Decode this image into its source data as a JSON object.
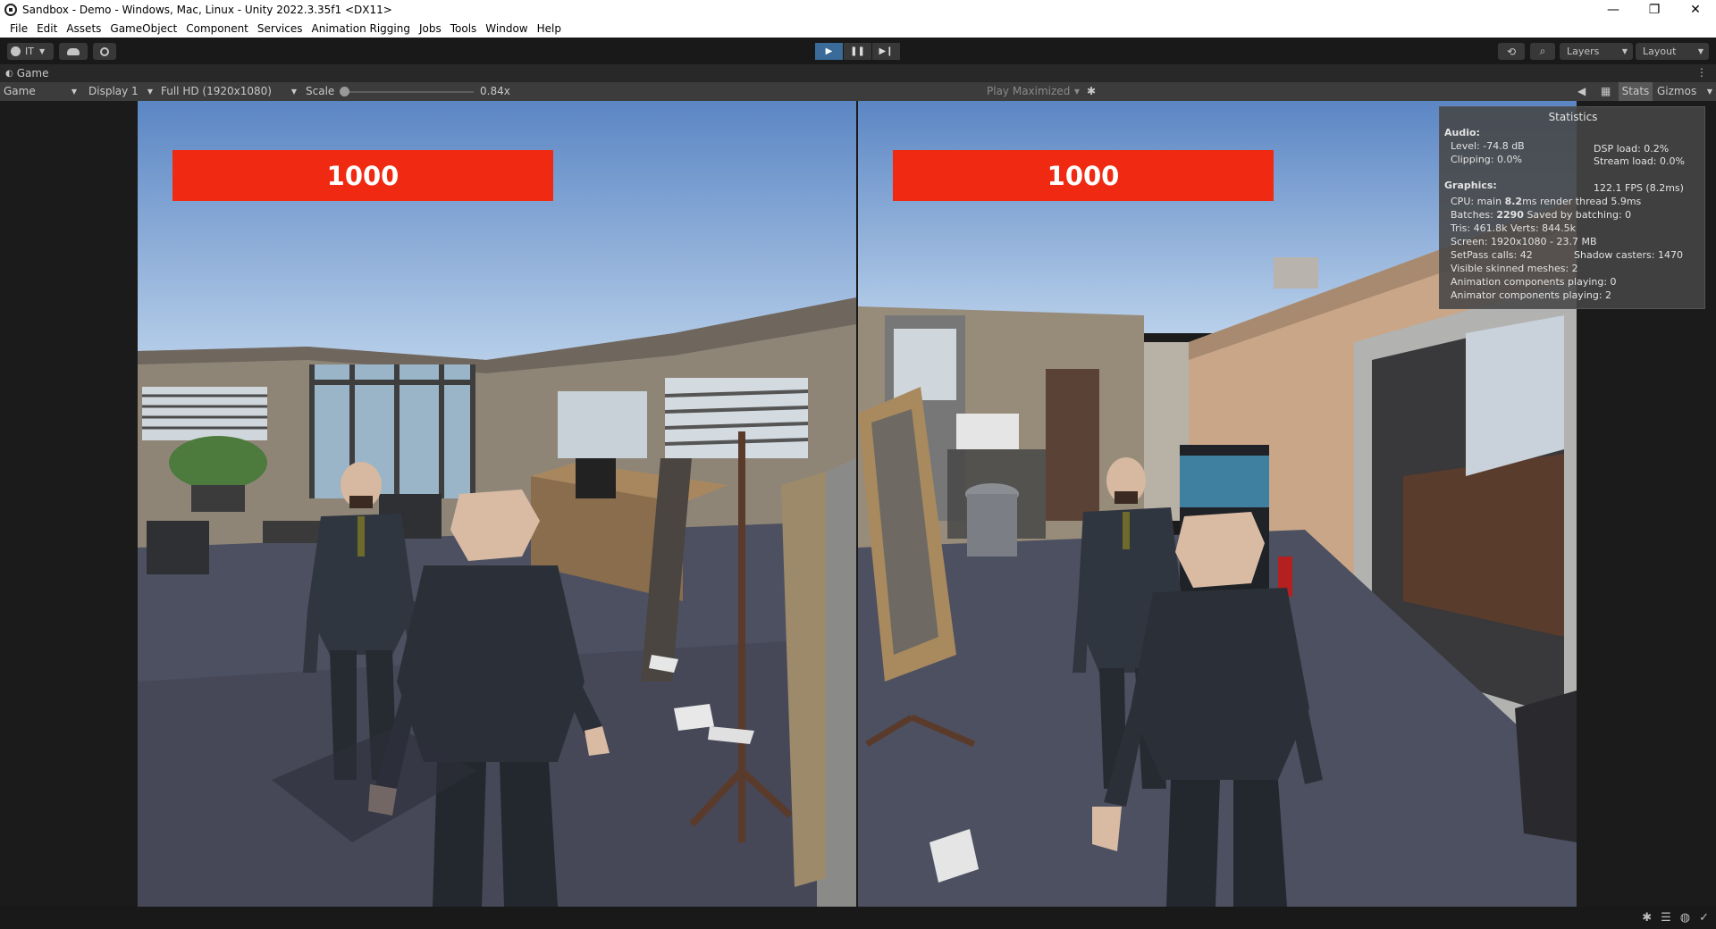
{
  "window": {
    "title": "Sandbox - Demo - Windows, Mac, Linux - Unity 2022.3.35f1 <DX11>",
    "minimize_glyph": "—",
    "restore_glyph": "❐",
    "close_glyph": "✕"
  },
  "menu": [
    "File",
    "Edit",
    "Assets",
    "GameObject",
    "Component",
    "Services",
    "Animation Rigging",
    "Jobs",
    "Tools",
    "Window",
    "Help"
  ],
  "toolbar": {
    "account_label": "IT",
    "layers_label": "Layers",
    "layout_label": "Layout",
    "play_state": "playing"
  },
  "game_tab": {
    "title": "Game"
  },
  "game_toolbar": {
    "view_select": "Game",
    "display_select": "Display 1",
    "resolution_select": "Full HD (1920x1080)",
    "scale_label": "Scale",
    "scale_value": "0.84x",
    "scale_fraction": 0,
    "play_mode_select": "Play Maximized",
    "stats_label": "Stats",
    "gizmos_label": "Gizmos"
  },
  "hud": {
    "left_score": "1000",
    "right_score": "1000"
  },
  "statistics": {
    "title": "Statistics",
    "audio_header": "Audio:",
    "level": "Level: -74.8 dB",
    "clipping": "Clipping: 0.0%",
    "dsp_load": "DSP load: 0.2%",
    "stream_load": "Stream load: 0.0%",
    "graphics_header": "Graphics:",
    "fps": "122.1 FPS (8.2ms)",
    "cpu_prefix": "CPU: main ",
    "cpu_main": "8.2",
    "cpu_suffix": "ms  render thread 5.9ms",
    "batches_prefix": "Batches: ",
    "batches_value": "2290",
    "batches_suffix": "   Saved by batching: 0",
    "tris_verts": "Tris: 461.8k     Verts: 844.5k",
    "screen": "Screen: 1920x1080 - 23.7 MB",
    "setpass": "SetPass calls: 42",
    "shadow_casters": "Shadow casters: 1470",
    "skinned_meshes": "Visible skinned meshes: 2",
    "animation_components": "Animation components playing: 0",
    "animator_components": "Animator components playing: 2"
  },
  "colors": {
    "score_box": "#f02a12",
    "play_active": "#3a6b99",
    "editor_bg": "#1e1e1e"
  }
}
